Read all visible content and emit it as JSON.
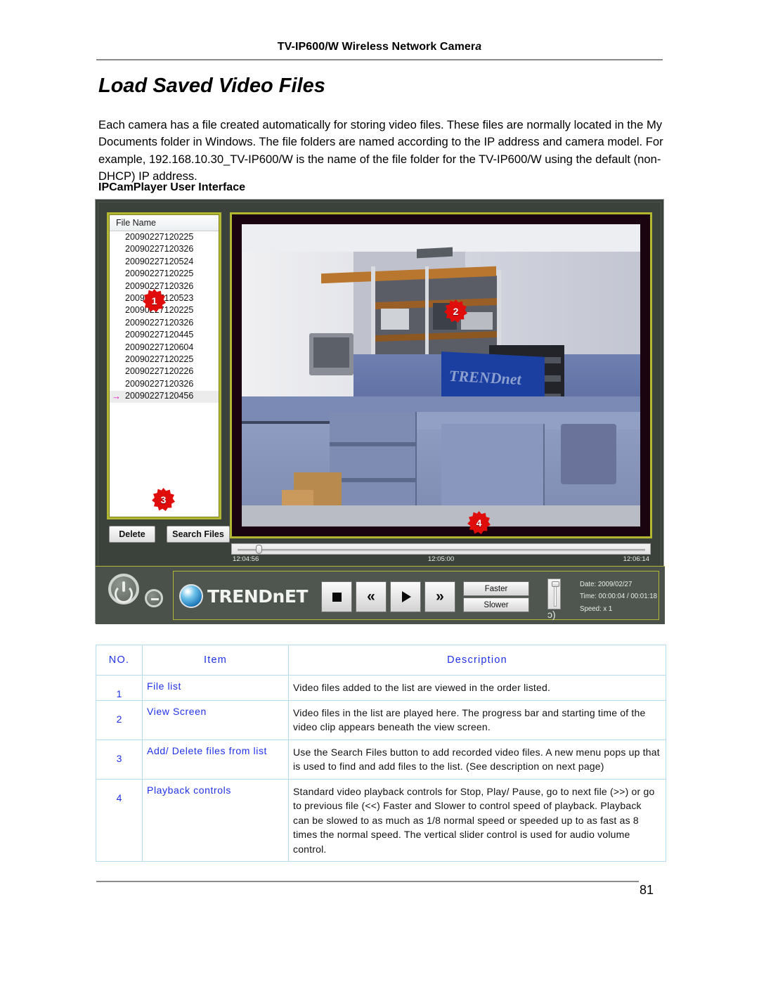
{
  "header": {
    "running_head_main": "TV-IP600/W Wireless Network Camer",
    "running_head_italic": "a"
  },
  "title": "Load Saved Video Files",
  "paragraph": "Each camera has a file created automatically for storing video files. These files are normally located in the My Documents folder in Windows. The file folders are named according to the IP address and camera model. For example, 192.168.10.30_TV-IP600/W is the name of the file folder for the TV-IP600/W using the default (non-DHCP) IP address.",
  "subheading": "IPCamPlayer User Interface",
  "app": {
    "file_panel": {
      "column_header": "File Name",
      "files": [
        "20090227120225",
        "20090227120326",
        "20090227120524",
        "20090227120225",
        "20090227120326",
        "20090227120523",
        "20090227120225",
        "20090227120326",
        "20090227120445",
        "20090227120604",
        "20090227120225",
        "20090227120226",
        "20090227120326",
        "20090227120456"
      ],
      "selected_file": "20090227120456",
      "selected_marker": "→"
    },
    "buttons": {
      "delete": "Delete",
      "search_files": "Search Files"
    },
    "video_banner_text": "TRENDnet",
    "timeline": {
      "start": "12:04:56",
      "middle": "12:05:00",
      "end": "12:06:14"
    },
    "brand": "TRENDnET",
    "playback": {
      "stop": "■",
      "previous": "«",
      "play": "▶",
      "next": "»",
      "faster": "Faster",
      "slower": "Slower",
      "speaker": "ᴐ)"
    },
    "info": {
      "date": "Date: 2009/02/27",
      "time": "Time: 00:00:04 / 00:01:18",
      "speed": "Speed: x 1"
    },
    "callouts": [
      "1",
      "2",
      "3",
      "4"
    ]
  },
  "table": {
    "headers": [
      "NO.",
      "Item",
      "Description"
    ],
    "rows": [
      {
        "no": "1",
        "item": "File list",
        "description": "Video files added to the list are viewed in the order listed."
      },
      {
        "no": "2",
        "item": "View Screen",
        "description": "Video files in the list are played here. The progress bar and starting time of the video clip appears beneath the view screen."
      },
      {
        "no": "3",
        "item": "Add/ Delete files from list",
        "description": "Use the Search Files button to add recorded video files. A new menu pops up that is used to find and add files to the list. (See description on next page)"
      },
      {
        "no": "4",
        "item": "Playback controls",
        "description": "Standard video playback controls for Stop, Play/ Pause, go to next file (>>) or go to previous file (<<) Faster and Slower to control speed of playback. Playback can be slowed to as much as 1/8 normal speed or speeded up to as fast as 8 times the normal speed. The vertical slider control is used for audio volume control."
      }
    ]
  },
  "footer": {
    "page_number": "81"
  },
  "colors": {
    "accent_yellow": "#b3b832",
    "badge_red": "#e00d0d",
    "table_text_blue": "#2030e8",
    "table_border_blue": "#b6dcf0",
    "app_frame": "#3b413b"
  }
}
